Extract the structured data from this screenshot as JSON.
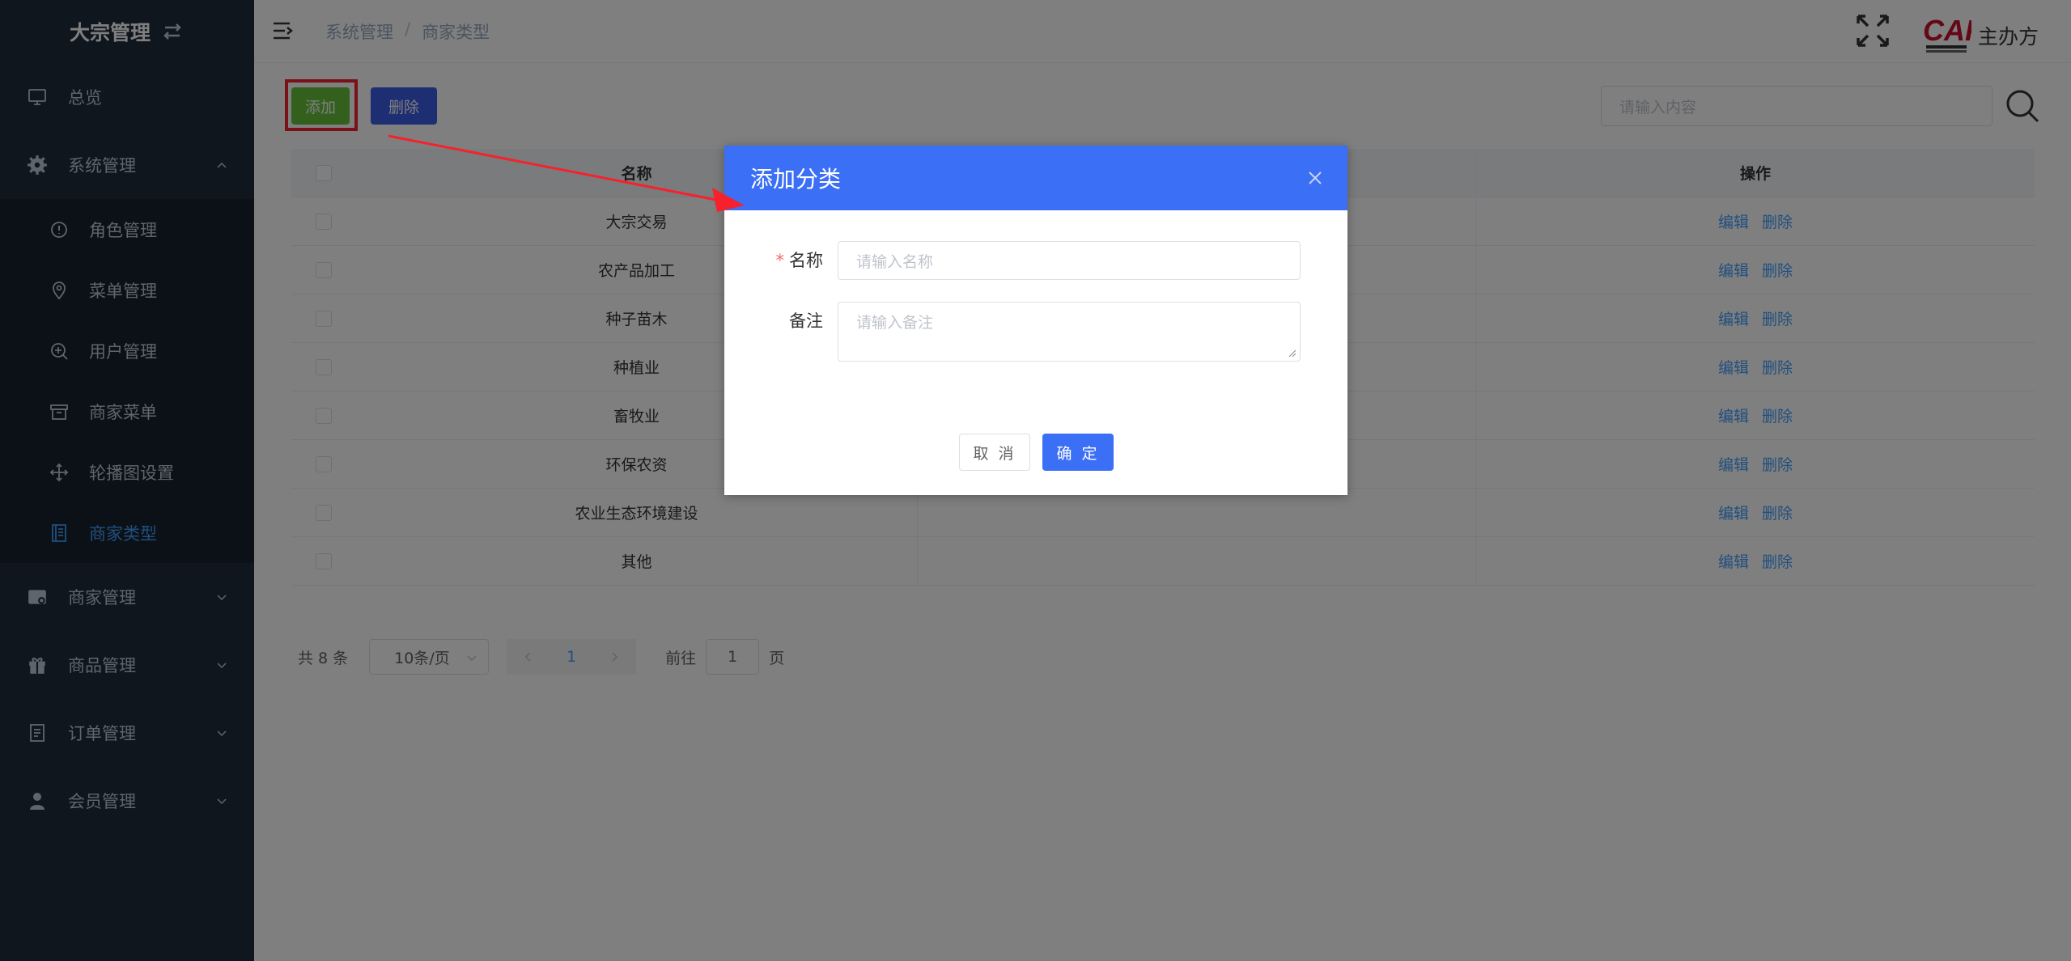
{
  "sidebar": {
    "logo": "大宗管理",
    "items": [
      {
        "label": "总览"
      },
      {
        "label": "系统管理"
      },
      {
        "label": "商家管理"
      },
      {
        "label": "商品管理"
      },
      {
        "label": "订单管理"
      },
      {
        "label": "会员管理"
      }
    ],
    "sub_items": [
      {
        "label": "角色管理"
      },
      {
        "label": "菜单管理"
      },
      {
        "label": "用户管理"
      },
      {
        "label": "商家菜单"
      },
      {
        "label": "轮播图设置"
      },
      {
        "label": "商家类型"
      }
    ]
  },
  "header": {
    "breadcrumb": [
      "系统管理",
      "/",
      "商家类型"
    ],
    "host_label": "主办方",
    "logo_text": "CAF"
  },
  "toolbar": {
    "add_label": "添加",
    "delete_label": "删除",
    "search_placeholder": "请输入内容"
  },
  "table": {
    "columns": [
      "名称",
      "",
      "操作"
    ],
    "rows": [
      {
        "name": "大宗交易"
      },
      {
        "name": "农产品加工"
      },
      {
        "name": "种子苗木"
      },
      {
        "name": "种植业"
      },
      {
        "name": "畜牧业"
      },
      {
        "name": "环保农资"
      },
      {
        "name": "农业生态环境建设"
      },
      {
        "name": "其他"
      }
    ],
    "edit_label": "编辑",
    "delete_label": "删除"
  },
  "pagination": {
    "total": "共 8 条",
    "page_size": "10条/页",
    "current": "1",
    "goto_prefix": "前往",
    "goto_value": "1",
    "goto_suffix": "页"
  },
  "dialog": {
    "title": "添加分类",
    "name_label": "名称",
    "name_placeholder": "请输入名称",
    "note_label": "备注",
    "note_placeholder": "请输入备注",
    "cancel_label": "取 消",
    "ok_label": "确 定"
  },
  "colors": {
    "sidebar_bg": "#1f2d3d",
    "accent": "#3b6ff5",
    "add_button": "#67c23a",
    "highlight": "#f5222d",
    "active_menu": "#409eff"
  }
}
